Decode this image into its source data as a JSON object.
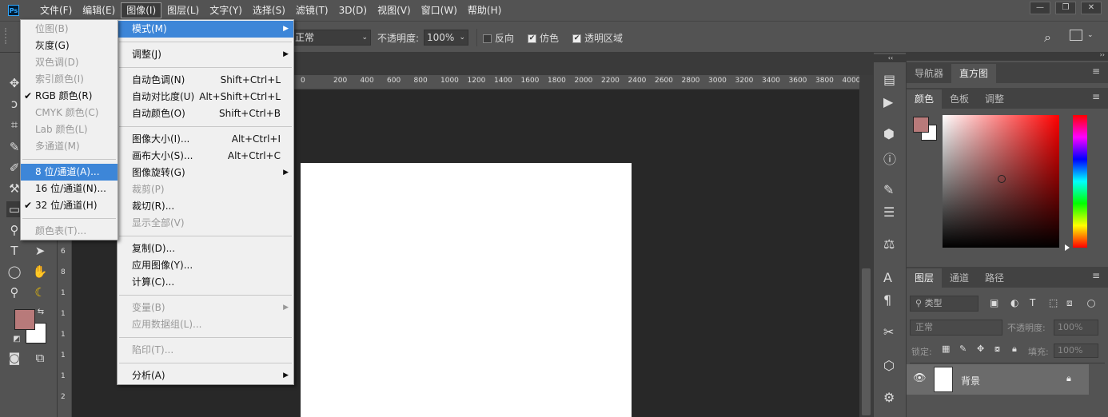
{
  "menubar": {
    "logo": "Ps",
    "items": [
      "文件(F)",
      "编辑(E)",
      "图像(I)",
      "图层(L)",
      "文字(Y)",
      "选择(S)",
      "滤镜(T)",
      "3D(D)",
      "视图(V)",
      "窗口(W)",
      "帮助(H)"
    ],
    "active_index": 2,
    "win_minimize": "—",
    "win_restore": "❐",
    "win_close": "✕"
  },
  "options": {
    "mode_value": "正常",
    "opacity_label": "不透明度:",
    "opacity_value": "100%",
    "reverse_label": "反向",
    "dither_label": "仿色",
    "transparency_label": "透明区域",
    "dither_checked": true,
    "transparency_checked": true
  },
  "ruler": {
    "h_ticks": [
      "200",
      "400",
      "600",
      "800",
      "1000",
      "1200",
      "1400",
      "1600",
      "1800",
      "2000",
      "2200",
      "2400",
      "2600",
      "2800",
      "3000",
      "3200",
      "3400",
      "3600",
      "3800",
      "4000"
    ],
    "h_first_label": "0",
    "v_ticks": [
      "6",
      "8",
      "1",
      "1",
      "1",
      "1",
      "1",
      "2"
    ]
  },
  "image_menu": {
    "items": [
      {
        "label": "模式(M)",
        "shortcut": "",
        "submenu": true,
        "highlight": true,
        "disabled": false
      },
      {
        "sep": true
      },
      {
        "label": "调整(J)",
        "shortcut": "",
        "submenu": true,
        "disabled": false
      },
      {
        "sep": true
      },
      {
        "label": "自动色调(N)",
        "shortcut": "Shift+Ctrl+L"
      },
      {
        "label": "自动对比度(U)",
        "shortcut": "Alt+Shift+Ctrl+L"
      },
      {
        "label": "自动颜色(O)",
        "shortcut": "Shift+Ctrl+B"
      },
      {
        "sep": true
      },
      {
        "label": "图像大小(I)...",
        "shortcut": "Alt+Ctrl+I"
      },
      {
        "label": "画布大小(S)...",
        "shortcut": "Alt+Ctrl+C"
      },
      {
        "label": "图像旋转(G)",
        "shortcut": "",
        "submenu": true
      },
      {
        "label": "裁剪(P)",
        "shortcut": "",
        "disabled": true
      },
      {
        "label": "裁切(R)...",
        "shortcut": ""
      },
      {
        "label": "显示全部(V)",
        "shortcut": "",
        "disabled": true
      },
      {
        "sep": true
      },
      {
        "label": "复制(D)...",
        "shortcut": ""
      },
      {
        "label": "应用图像(Y)...",
        "shortcut": ""
      },
      {
        "label": "计算(C)...",
        "shortcut": ""
      },
      {
        "sep": true
      },
      {
        "label": "变量(B)",
        "shortcut": "",
        "submenu": true,
        "disabled": true
      },
      {
        "label": "应用数据组(L)...",
        "shortcut": "",
        "disabled": true
      },
      {
        "sep": true
      },
      {
        "label": "陷印(T)...",
        "shortcut": "",
        "disabled": true
      },
      {
        "sep": true
      },
      {
        "label": "分析(A)",
        "shortcut": "",
        "submenu": true
      }
    ]
  },
  "mode_submenu": {
    "items": [
      {
        "label": "位图(B)",
        "disabled": true
      },
      {
        "label": "灰度(G)"
      },
      {
        "label": "双色调(D)",
        "disabled": true
      },
      {
        "label": "索引颜色(I)",
        "disabled": true
      },
      {
        "label": "RGB 颜色(R)",
        "checked": true
      },
      {
        "label": "CMYK 颜色(C)",
        "disabled": true
      },
      {
        "label": "Lab 颜色(L)",
        "disabled": true
      },
      {
        "label": "多通道(M)",
        "disabled": true
      },
      {
        "sep": true
      },
      {
        "label": "8 位/通道(A)...",
        "highlight": true
      },
      {
        "label": "16 位/通道(N)..."
      },
      {
        "label": "32 位/通道(H)",
        "checked": true
      },
      {
        "sep": true
      },
      {
        "label": "颜色表(T)...",
        "disabled": true
      }
    ],
    "check_glyph": "✔"
  },
  "right_panel": {
    "nav_tabs": [
      "导航器",
      "直方图"
    ],
    "color_tabs": [
      "颜色",
      "色板",
      "调整"
    ],
    "layer_tabs": [
      "图层",
      "通道",
      "路径"
    ],
    "filter_label": "类型",
    "blend_mode": "正常",
    "opacity_label": "不透明度:",
    "opacity_value": "100%",
    "lock_label": "锁定:",
    "fill_label": "填充:",
    "fill_value": "100%",
    "layer_name": "背景",
    "menu_glyph": "≡"
  },
  "colors": {
    "foreground": "#b87a7a",
    "background": "#ffffff",
    "highlight": "#3d86d8"
  }
}
